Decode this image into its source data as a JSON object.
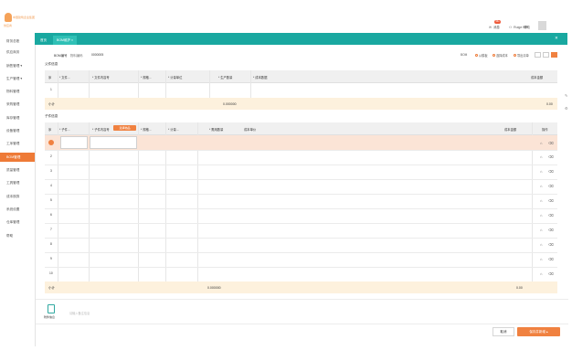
{
  "app": {
    "logo_text_1": "中国建筑企业集团",
    "logo_text_2": "供应商",
    "messages_label": "消息",
    "messages_badge": "99+",
    "user_label": "Ruige HR",
    "help_label": "帮助"
  },
  "sidebar": {
    "items": [
      {
        "label": "财务总账",
        "active": false
      },
      {
        "label": "供应商务",
        "active": false
      },
      {
        "label": "销售管理 ▾",
        "active": false
      },
      {
        "label": "生产管理 ▾",
        "active": false
      },
      {
        "label": "物料管理",
        "active": false
      },
      {
        "label": "采购管理",
        "active": false
      },
      {
        "label": "库存管理",
        "active": false
      },
      {
        "label": "设备管理",
        "active": false
      },
      {
        "label": "工序管理",
        "active": false
      },
      {
        "label": "BOM管理",
        "active": true
      },
      {
        "label": "质量管理",
        "active": false
      },
      {
        "label": "工具管理",
        "active": false
      },
      {
        "label": "成本核算",
        "active": false
      },
      {
        "label": "系统设置",
        "active": false
      },
      {
        "label": "仓库管理",
        "active": false
      },
      {
        "label": "帮助",
        "active": false
      }
    ]
  },
  "tabs": [
    {
      "label": "首页",
      "active": false
    },
    {
      "label": "BOM维护 ×",
      "active": true
    }
  ],
  "header": {
    "bom_no_label": "BOM编号",
    "source_label": "物料编码",
    "source_value": "0000005"
  },
  "toolbar": {
    "items": [
      "BOM",
      "从模板",
      "选择成本",
      "导出清单"
    ]
  },
  "parent_section": {
    "title": "父件信息",
    "columns": [
      "序",
      "* 文件...",
      "* 文件内容号",
      "* 规格...",
      "* 计量单位",
      "* 生产数量",
      "* 成本数据",
      "成本金额"
    ],
    "rows": [
      {
        "index": "1"
      }
    ],
    "total_label": "小计",
    "total_qty": "0.000000",
    "total_amount": "0.00"
  },
  "child_section": {
    "title": "子件信息",
    "columns": [
      "序",
      "* 子件...",
      "* 子件内容号",
      "* 规格...",
      "* 计量...",
      "* 需用数量",
      "成本单价",
      "成本金额",
      "操作"
    ],
    "popup_tag": "选择物品",
    "rows": [
      {
        "index": "1"
      },
      {
        "index": "2"
      },
      {
        "index": "3"
      },
      {
        "index": "4"
      },
      {
        "index": "5"
      },
      {
        "index": "6"
      },
      {
        "index": "7"
      },
      {
        "index": "8"
      },
      {
        "index": "9"
      },
      {
        "index": "10"
      }
    ],
    "total_label": "小计",
    "total_qty": "0.000000",
    "total_amount": "0.00"
  },
  "attachment": {
    "label": "附件信息",
    "placeholder": "请输入备注信息"
  },
  "footer": {
    "cancel_label": "取消",
    "save_label": "保存并新增 ▴"
  },
  "colors": {
    "accent_teal": "#19a8a0",
    "accent_orange": "#f08140",
    "total_row": "#fdf1dd"
  }
}
